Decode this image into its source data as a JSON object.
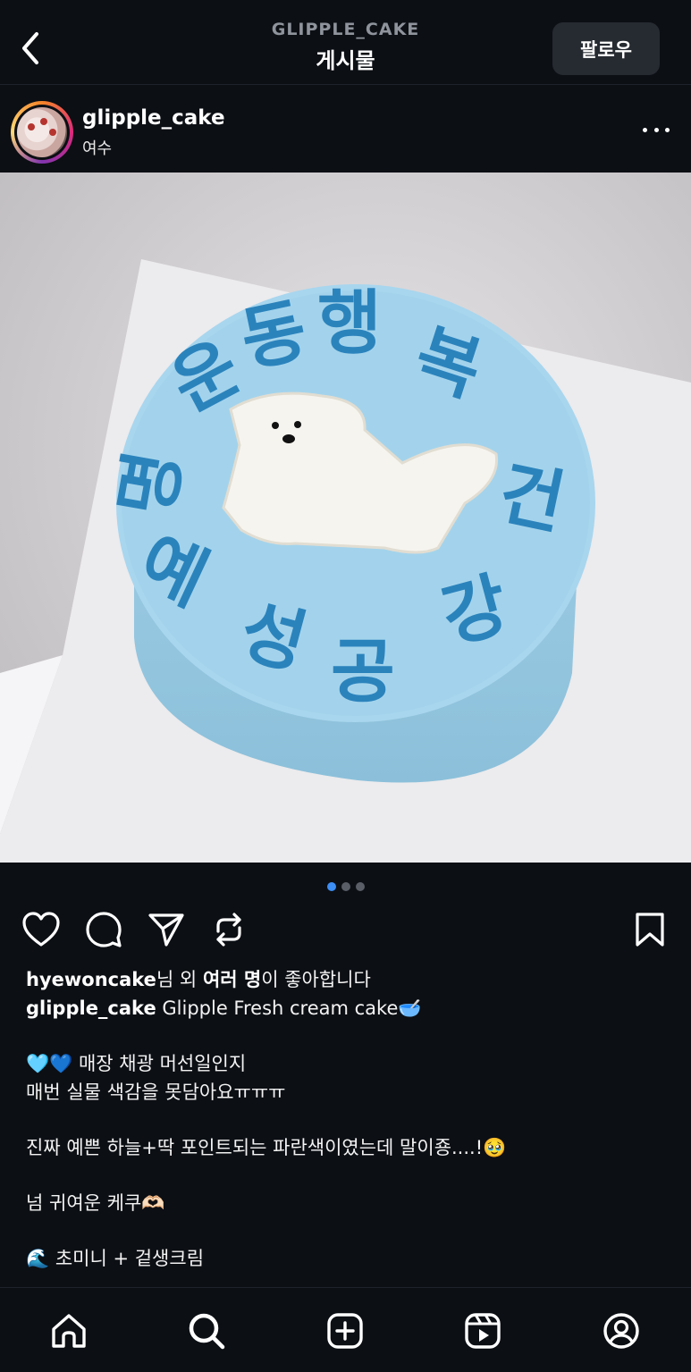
{
  "header": {
    "username": "GLIPPLE_CAKE",
    "title": "게시물",
    "follow_label": "팔로우"
  },
  "post": {
    "username": "glipple_cake",
    "location": "여수",
    "image_alt": "Blue fresh cream cake with white dog drawing and Korean lettering",
    "cake_text": [
      "동",
      "행",
      "복",
      "건",
      "강",
      "공",
      "성",
      "예",
      "명",
      "운"
    ],
    "carousel": {
      "count": 3,
      "active": 0
    }
  },
  "icons": {
    "back": "chevron-left-icon",
    "more": "more-horizontal-icon",
    "like": "heart-icon",
    "comment": "comment-icon",
    "share": "send-icon",
    "repost": "repost-icon",
    "save": "bookmark-icon"
  },
  "likes": {
    "user": "hyewoncake",
    "middle": "님 외 ",
    "others": "여러 명",
    "suffix": "이 좋아합니다"
  },
  "caption": {
    "author": "glipple_cake",
    "text": "Glipple Fresh cream cake🥣",
    "line1": "🩵💙 매장 채광 머선일인지",
    "line2": "매번 실물 색감을 못담아요ㅠㅠㅠ",
    "line3": "진짜 예쁜 하늘+딱 포인트되는 파란색이였는데 말이죵....!🥹",
    "line4": "넘 귀여운 케쿠🫶🏻",
    "line5": "🌊 초미니 + 겉생크림"
  },
  "nav": [
    "home-icon",
    "search-icon",
    "create-icon",
    "reels-icon",
    "profile-icon"
  ],
  "colors": {
    "background": "#0c0f14",
    "cake_blue": "#a3d4ec",
    "lettering_blue": "#2a7fb8",
    "carousel_active": "#3d8ef5"
  }
}
